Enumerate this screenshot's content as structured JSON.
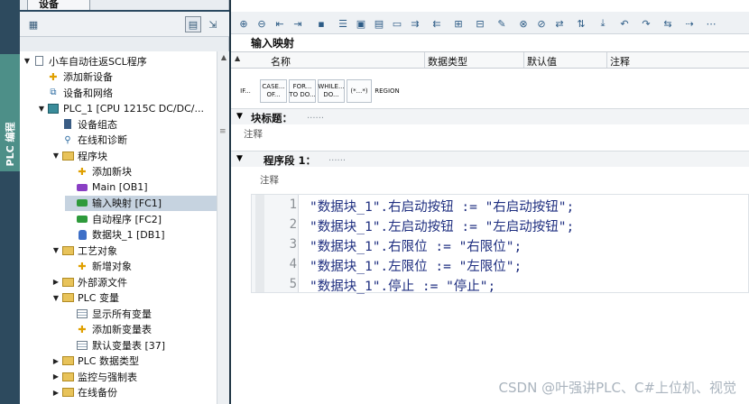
{
  "left_strip": {
    "vertical_tab_label": "PLC 编程"
  },
  "tree_pane": {
    "title": "设备",
    "items": [
      {
        "label": "小车自动往返SCL程序",
        "depth": 0,
        "expand": "▼",
        "icon": "project-icon"
      },
      {
        "label": "添加新设备",
        "depth": 1,
        "expand": "",
        "icon": "add-device-icon"
      },
      {
        "label": "设备和网络",
        "depth": 1,
        "expand": "",
        "icon": "network-icon"
      },
      {
        "label": "PLC_1 [CPU 1215C DC/DC/...",
        "depth": 1,
        "expand": "▼",
        "icon": "plc-icon"
      },
      {
        "label": "设备组态",
        "depth": 2,
        "expand": "",
        "icon": "device-config-icon"
      },
      {
        "label": "在线和诊断",
        "depth": 2,
        "expand": "",
        "icon": "diagnostics-icon"
      },
      {
        "label": "程序块",
        "depth": 2,
        "expand": "▼",
        "icon": "folder-icon"
      },
      {
        "label": "添加新块",
        "depth": 3,
        "expand": "",
        "icon": "add-block-icon"
      },
      {
        "label": "Main [OB1]",
        "depth": 3,
        "expand": "",
        "icon": "ob-block-icon"
      },
      {
        "label": "输入映射 [FC1]",
        "depth": 3,
        "expand": "",
        "icon": "fc-block-icon",
        "selected": true
      },
      {
        "label": "自动程序 [FC2]",
        "depth": 3,
        "expand": "",
        "icon": "fc-block-icon"
      },
      {
        "label": "数据块_1 [DB1]",
        "depth": 3,
        "expand": "",
        "icon": "db-block-icon"
      },
      {
        "label": "工艺对象",
        "depth": 2,
        "expand": "▼",
        "icon": "folder-icon"
      },
      {
        "label": "新增对象",
        "depth": 3,
        "expand": "",
        "icon": "add-object-icon"
      },
      {
        "label": "外部源文件",
        "depth": 2,
        "expand": "▶",
        "icon": "folder-icon"
      },
      {
        "label": "PLC 变量",
        "depth": 2,
        "expand": "▼",
        "icon": "folder-icon"
      },
      {
        "label": "显示所有变量",
        "depth": 3,
        "expand": "",
        "icon": "tag-table-icon"
      },
      {
        "label": "添加新变量表",
        "depth": 3,
        "expand": "",
        "icon": "add-tag-table-icon"
      },
      {
        "label": "默认变量表 [37]",
        "depth": 3,
        "expand": "",
        "icon": "tag-table-icon"
      },
      {
        "label": "PLC 数据类型",
        "depth": 2,
        "expand": "▶",
        "icon": "folder-icon"
      },
      {
        "label": "监控与强制表",
        "depth": 2,
        "expand": "▶",
        "icon": "folder-icon"
      },
      {
        "label": "在线备份",
        "depth": 2,
        "expand": "▶",
        "icon": "folder-icon"
      }
    ]
  },
  "editor": {
    "block_title": "输入映射",
    "interface_columns": [
      "名称",
      "数据类型",
      "默认值",
      "注释"
    ],
    "templates": [
      "IF...",
      "CASE...\nOF...",
      "FOR...\nTO DO...",
      "WHILE...\nDO...",
      "(*...*)",
      "REGION"
    ],
    "block_heading": "块标题：",
    "block_heading_dots": "......",
    "block_comment": "注释",
    "network_title": "程序段 1：",
    "network_dots": "......",
    "network_comment": "注释",
    "code_lines": [
      {
        "num": "1",
        "text": "\"数据块_1\".右启动按钮 := \"右启动按钮\";"
      },
      {
        "num": "2",
        "text": "\"数据块_1\".左启动按钮 := \"左启动按钮\";"
      },
      {
        "num": "3",
        "text": "\"数据块_1\".右限位 := \"右限位\";"
      },
      {
        "num": "4",
        "text": "\"数据块_1\".左限位 := \"左限位\";"
      },
      {
        "num": "5",
        "text": "\"数据块_1\".停止 := \"停止\";"
      }
    ]
  },
  "watermark": "CSDN @叶强讲PLC、C#上位机、视觉",
  "colors": {
    "tree_selection": "#c6d3e0",
    "vertical_tab": "#4d8f88",
    "code_text": "#1f2f80",
    "fc_block": "#2e9a3b",
    "ob_block": "#8a3fc4",
    "db_block": "#3d6fc7"
  }
}
